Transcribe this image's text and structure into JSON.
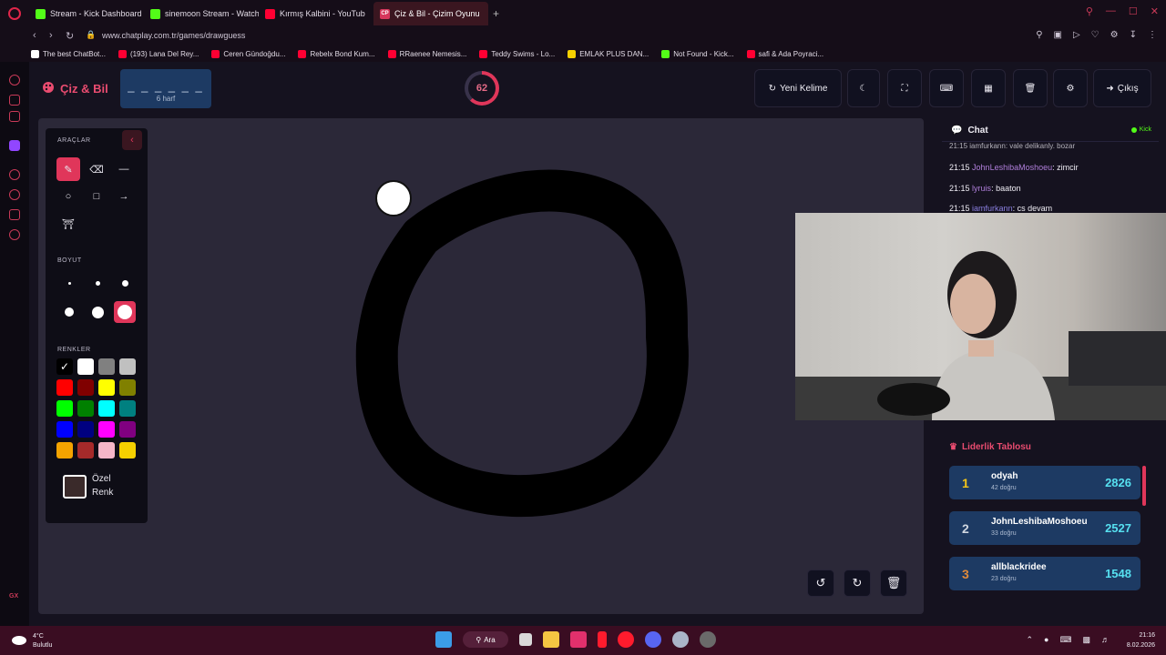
{
  "browser": {
    "tabs": [
      {
        "label": "Stream - Kick Dashboard",
        "fav": "kick",
        "active": false
      },
      {
        "label": "sinemoon Stream - Watch",
        "fav": "kick",
        "active": false
      },
      {
        "label": "Kırmış Kalbini - YouTub",
        "fav": "youtube",
        "active": false
      },
      {
        "label": "Çiz & Bil - Çizim Oyunu",
        "fav": "cp",
        "active": true
      }
    ],
    "url": "www.chatplay.com.tr/games/drawguess",
    "bookmarks": [
      {
        "label": "The best ChatBot...",
        "color": "#ffffff"
      },
      {
        "label": "(193) Lana Del Rey...",
        "color": "#ff0033"
      },
      {
        "label": "Ceren Gündoğdu...",
        "color": "#ff0033"
      },
      {
        "label": "Rebelx Bond Kum...",
        "color": "#ff0033"
      },
      {
        "label": "RRaenee Nemesis...",
        "color": "#ff0033"
      },
      {
        "label": "Teddy Swims - Lo...",
        "color": "#ff0033"
      },
      {
        "label": "EMLAK PLUS DAN...",
        "color": "#f5d000"
      },
      {
        "label": "Not Found - Kick...",
        "color": "#53fc18"
      },
      {
        "label": "safi & Ada Poyraci...",
        "color": "#ff0033"
      }
    ],
    "sidebar_badge": "GX"
  },
  "app": {
    "brand": "Çiz & Bil",
    "word_mask": "_ _ _ _ _ _",
    "word_length": "6 harf",
    "timer": "62",
    "new_word_label": "Yeni Kelime",
    "exit_label": "Çıkış"
  },
  "tools": {
    "title_tools": "ARAÇLAR",
    "title_size": "BOYUT",
    "title_colors": "RENKLER",
    "custom_color_label": "Özel Renk",
    "swatches": [
      "#000000",
      "#ffffff",
      "#808080",
      "#c0c0c0",
      "#ff0000",
      "#800000",
      "#ffff00",
      "#808000",
      "#00ff00",
      "#008000",
      "#00ffff",
      "#008080",
      "#0000ff",
      "#000080",
      "#ff00ff",
      "#800080",
      "#f4a300",
      "#a52a2a",
      "#f5b6c8",
      "#f5d000"
    ]
  },
  "chat": {
    "title": "Chat",
    "platform": "Kick",
    "partial_top": "21:15 iamfurkann: vale delikanly. bozar",
    "messages": [
      {
        "time": "21:15",
        "user": "JohnLeshibaMoshoeu",
        "text": ": zimcir"
      },
      {
        "time": "21:15",
        "user": "lyruis",
        "text": ": baaton"
      },
      {
        "time": "21:15",
        "user": "iamfurkann",
        "text": ": cs devam"
      }
    ]
  },
  "leaderboard": {
    "title": "Liderlik Tablosu",
    "rows": [
      {
        "rank": "1",
        "name": "odyah",
        "sub": "42 doğru",
        "score": "2826",
        "rank_color": "#f5c518"
      },
      {
        "rank": "2",
        "name": "JohnLeshibaMoshoeu",
        "sub": "33 doğru",
        "score": "2527",
        "rank_color": "#cfd6e0"
      },
      {
        "rank": "3",
        "name": "allblackridee",
        "sub": "23 doğru",
        "score": "1548",
        "rank_color": "#e08a3a"
      }
    ]
  },
  "taskbar": {
    "temperature": "4°C",
    "condition": "Bulutlu",
    "search_label": "Ara",
    "time": "21:16",
    "date": "8.02.2026"
  }
}
